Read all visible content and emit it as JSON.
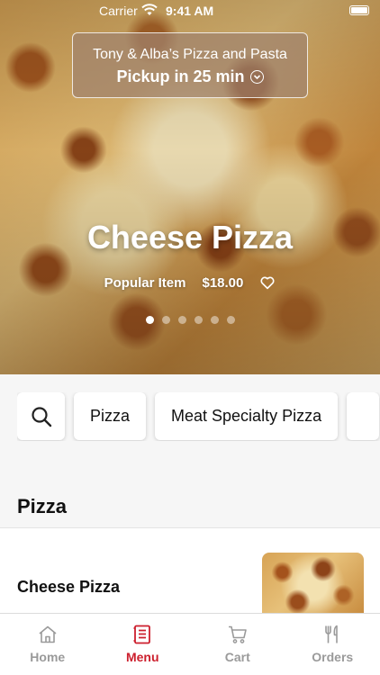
{
  "status_bar": {
    "carrier": "Carrier",
    "time": "9:41 AM"
  },
  "restaurant": {
    "name": "Tony & Alba’s Pizza and Pasta",
    "pickup": "Pickup in 25 min"
  },
  "hero": {
    "title": "Cheese Pizza",
    "tag": "Popular Item",
    "price": "$18.00",
    "slide_count": 6,
    "active_slide": 1
  },
  "categories": [
    "Pizza",
    "Meat Specialty Pizza"
  ],
  "section": {
    "title": "Pizza"
  },
  "items": [
    {
      "name": "Cheese Pizza"
    }
  ],
  "tabs": [
    {
      "label": "Home",
      "icon": "home-icon"
    },
    {
      "label": "Menu",
      "icon": "menu-icon",
      "active": true
    },
    {
      "label": "Cart",
      "icon": "cart-icon"
    },
    {
      "label": "Orders",
      "icon": "fork-knife-icon"
    }
  ],
  "colors": {
    "accent": "#cc1f2d",
    "inactive_tab": "#9a9a9a"
  }
}
